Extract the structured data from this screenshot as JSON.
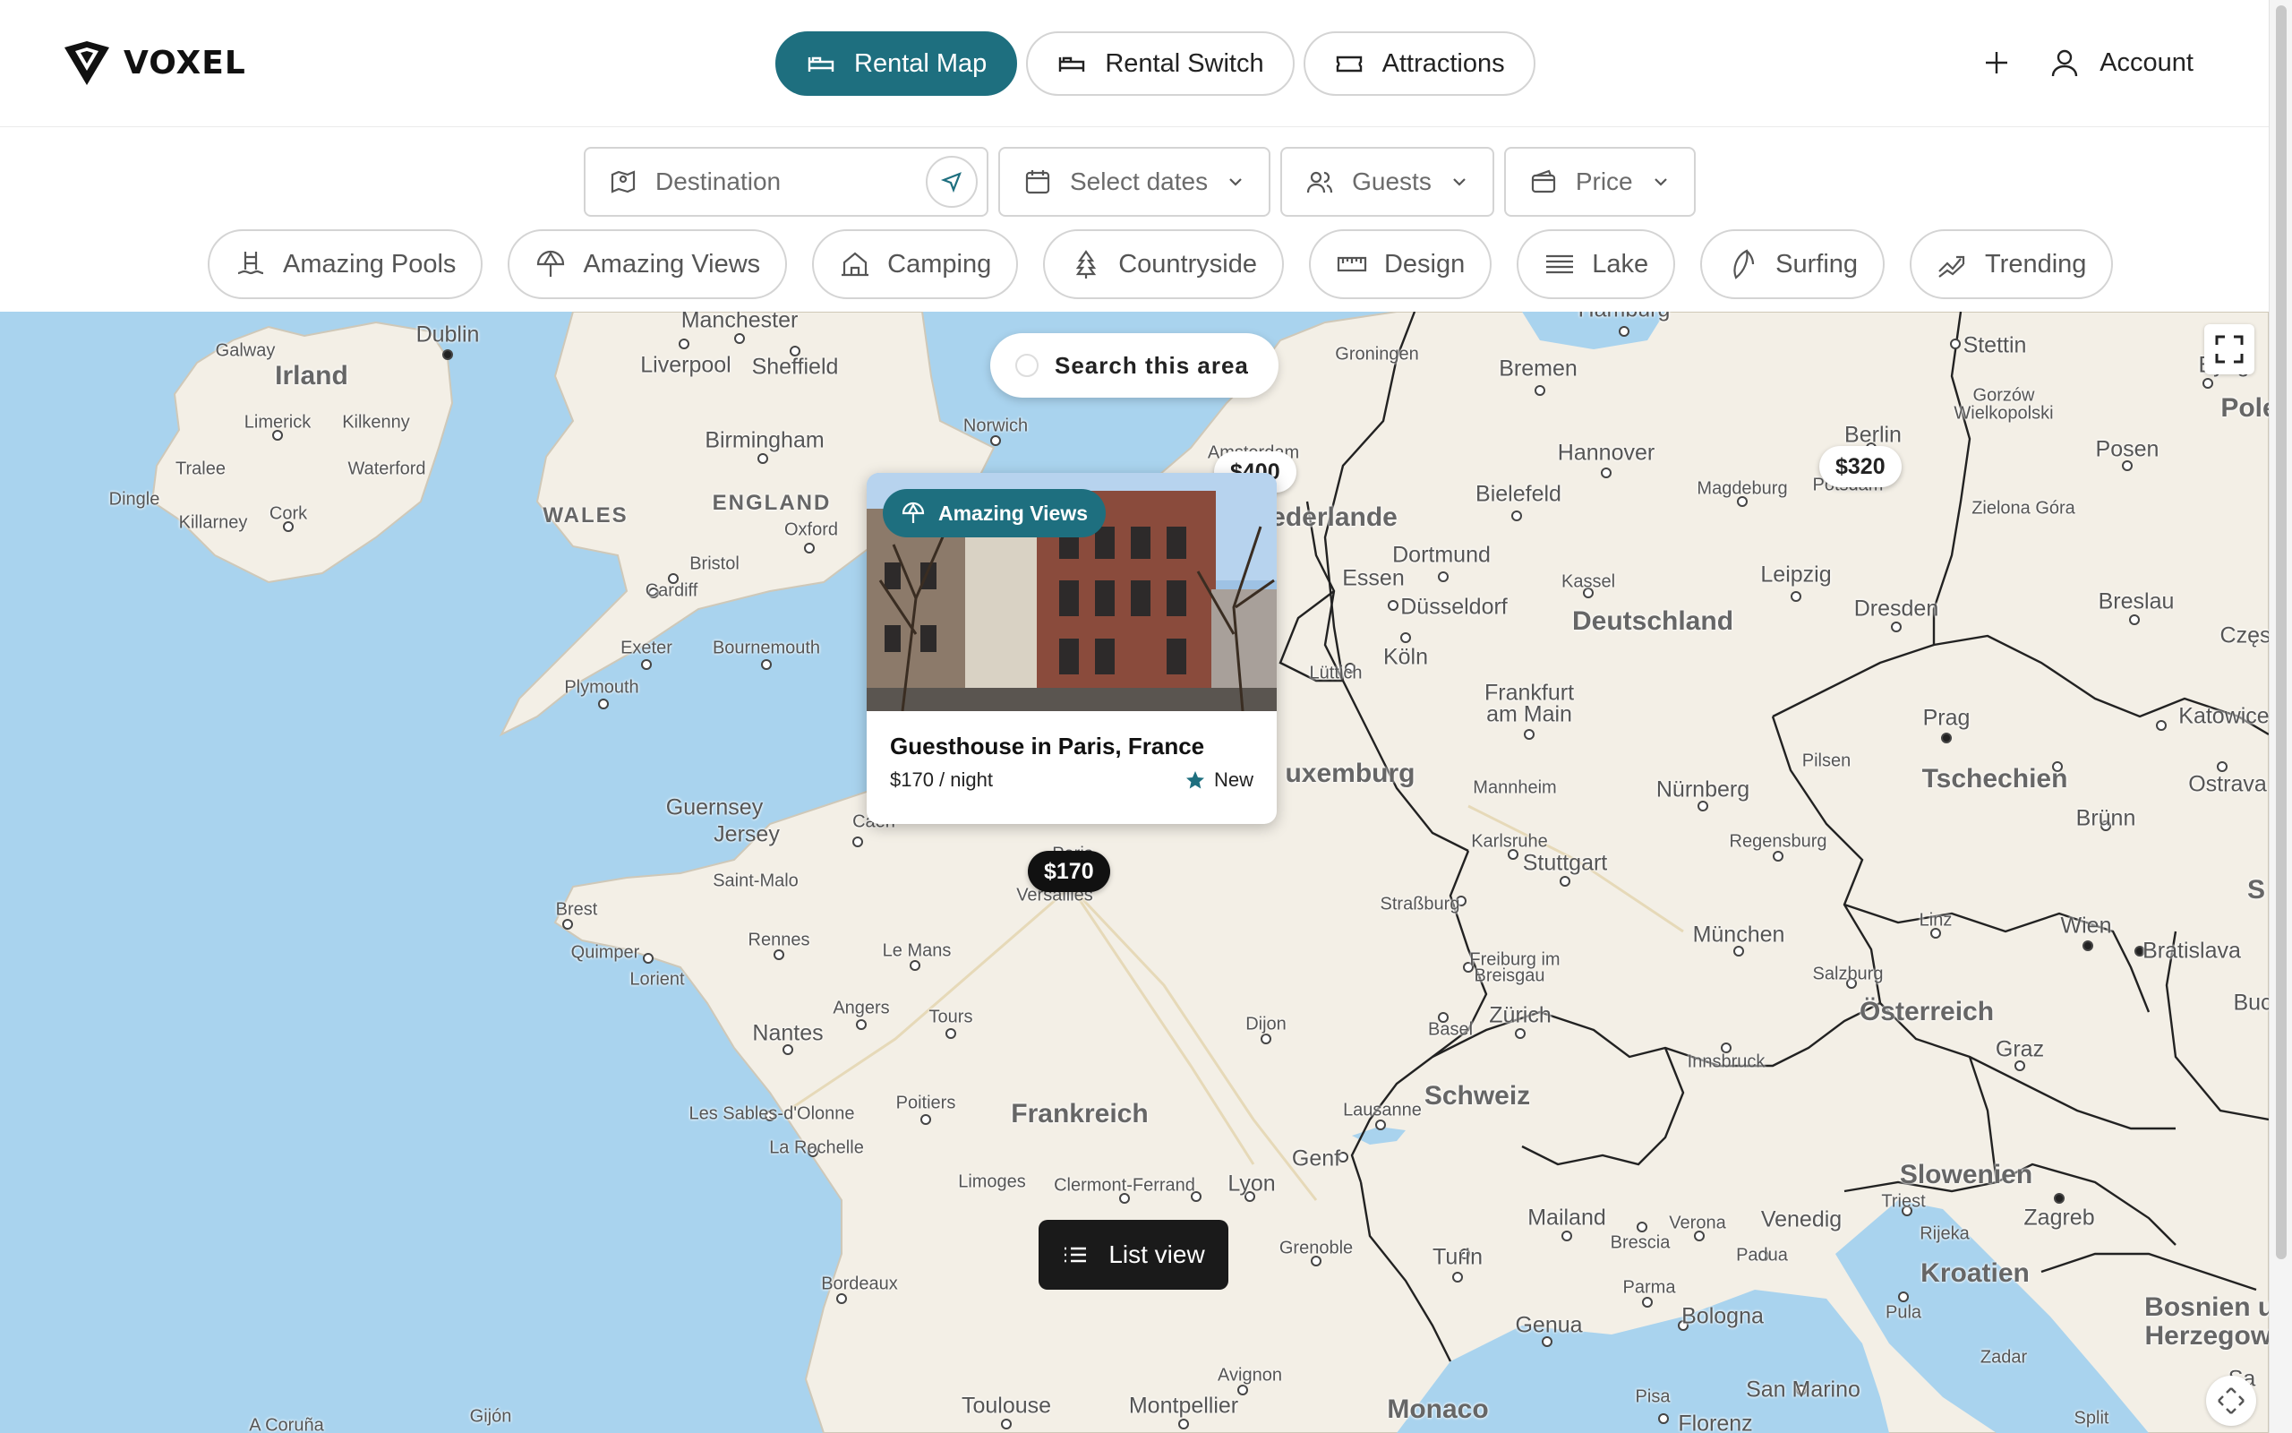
{
  "brand": {
    "name": "VOXEL"
  },
  "nav": {
    "tabs": [
      {
        "label": "Rental Map",
        "icon": "bed-icon",
        "active": true
      },
      {
        "label": "Rental Switch",
        "icon": "bed-icon",
        "active": false
      },
      {
        "label": "Attractions",
        "icon": "ticket-icon",
        "active": false
      }
    ],
    "account_label": "Account"
  },
  "search": {
    "destination_placeholder": "Destination",
    "dates_label": "Select dates",
    "guests_label": "Guests",
    "price_label": "Price"
  },
  "categories": [
    {
      "label": "Amazing Pools",
      "icon": "pool-icon"
    },
    {
      "label": "Amazing Views",
      "icon": "umbrella-icon"
    },
    {
      "label": "Camping",
      "icon": "tent-icon"
    },
    {
      "label": "Countryside",
      "icon": "tree-icon"
    },
    {
      "label": "Design",
      "icon": "ruler-icon"
    },
    {
      "label": "Lake",
      "icon": "waves-icon"
    },
    {
      "label": "Surfing",
      "icon": "surf-icon"
    },
    {
      "label": "Trending",
      "icon": "trending-icon"
    }
  ],
  "map": {
    "search_area_label": "Search this area",
    "list_view_label": "List view",
    "price_pins": [
      "$400",
      "$320",
      "$170"
    ],
    "labels": {
      "irland": "Irland",
      "wales": "WALES",
      "england": "ENGLAND",
      "frankreich": "Frankreich",
      "deutschland": "Deutschland",
      "schweiz": "Schweiz",
      "osterreich": "Österreich",
      "tschechien": "Tschechien",
      "slowenien": "Slowenien",
      "kroatien": "Kroatien",
      "bosnien1": "Bosnien und",
      "bosnien2": "Herzegowina",
      "luxemburg": "uxemburg",
      "nederlande": "ederlande",
      "guernsey": "Guernsey",
      "jersey": "Jersey",
      "monaco": "Monaco",
      "san_marino": "San Marino",
      "dublin": "Dublin",
      "galway": "Galway",
      "limerick": "Limerick",
      "kilkenny": "Kilkenny",
      "tralee": "Tralee",
      "waterford": "Waterford",
      "dingle": "Dingle",
      "killarney": "Killarney",
      "cork": "Cork",
      "manchester": "Manchester",
      "liverpool": "Liverpool",
      "sheffield": "Sheffield",
      "birmingham": "Birmingham",
      "norwich": "Norwich",
      "oxford": "Oxford",
      "bristol": "Bristol",
      "cardiff": "Cardiff",
      "exeter": "Exeter",
      "bournemouth": "Bournemouth",
      "plymouth": "Plymouth",
      "amsterdam": "Amsterdam",
      "hamburg": "Hamburg",
      "bremen": "Bremen",
      "groningen": "Groningen",
      "hannover": "Hannover",
      "bielefeld": "Bielefeld",
      "berlin": "Berlin",
      "stettin": "Stettin",
      "bydg": "Bydg",
      "gorzow": "Gorzów",
      "wielkopolski": "Wielkopolski",
      "pole": "Pole",
      "posen": "Posen",
      "magdeburg": "Magdeburg",
      "potsdam": "Potsdam",
      "zielona": "Zielona Góra",
      "dortmund": "Dortmund",
      "essen": "Essen",
      "dusseldorf": "Düsseldorf",
      "kassel": "Kassel",
      "leipzig": "Leipzig",
      "dresden": "Dresden",
      "breslau": "Breslau",
      "czes": "Częs",
      "koln": "Köln",
      "luttich": "Lüttich",
      "frankfurt1": "Frankfurt",
      "frankfurt2": "am Main",
      "prag": "Prag",
      "katowice": "Katowice",
      "pilsen": "Pilsen",
      "ostrava": "Ostrava",
      "nurnberg": "Nürnberg",
      "mannheim": "Mannheim",
      "karlsruhe": "Karlsruhe",
      "stuttgart": "Stuttgart",
      "regensburg": "Regensburg",
      "brunn": "Brünn",
      "strassburg": "Straßburg",
      "munchen": "München",
      "linz": "Linz",
      "wien": "Wien",
      "bratislava": "Bratislava",
      "freiburg1": "Freiburg im",
      "freiburg2": "Breisgau",
      "salzburg": "Salzburg",
      "basel": "Basel",
      "zurich": "Zürich",
      "innsbruck": "Innsbruck",
      "graz": "Graz",
      "lausanne": "Lausanne",
      "genf": "Genf",
      "mailand": "Mailand",
      "verona": "Verona",
      "venedig": "Venedig",
      "brescia": "Brescia",
      "padua": "Padua",
      "triest": "Triest",
      "rijeka": "Rijeka",
      "zagreb": "Zagreb",
      "turin": "Turin",
      "parma": "Parma",
      "bologna": "Bologna",
      "genua": "Genua",
      "pula": "Pula",
      "zadar": "Zadar",
      "pisa": "Pisa",
      "florenz": "Florenz",
      "split": "Split",
      "sarajevo": "Sa",
      "caen": "Caen",
      "paris": "Paris",
      "versailles": "Versailles",
      "saint_malo": "Saint-Malo",
      "brest": "Brest",
      "rennes": "Rennes",
      "quimper": "Quimper",
      "lorient": "Lorient",
      "le_mans": "Le Mans",
      "angers": "Angers",
      "tours": "Tours",
      "nantes": "Nantes",
      "dijon": "Dijon",
      "poitiers": "Poitiers",
      "les_sables": "Les Sables-d'Olonne",
      "la_rochelle": "La Rochelle",
      "limoges": "Limoges",
      "clermont": "Clermont-Ferrand",
      "lyon": "Lyon",
      "grenoble": "Grenoble",
      "bordeaux": "Bordeaux",
      "avignon": "Avignon",
      "toulouse": "Toulouse",
      "montpellier": "Montpellier",
      "la_coruna": "A Coruña",
      "gijon": "Gijón",
      "buc": "Buc",
      "s_edge": "S"
    }
  },
  "listing": {
    "badge": "Amazing Views",
    "title": "Guesthouse in Paris, France",
    "price": "$170 / night",
    "rating": "New"
  },
  "colors": {
    "brand_teal": "#1e6f7f",
    "map_water": "#a9d3ee",
    "map_land": "#f3efe6",
    "dark_button": "#1a1a1a"
  }
}
